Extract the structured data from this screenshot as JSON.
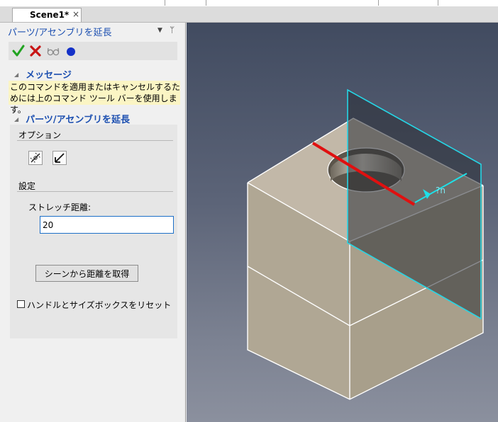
{
  "tab": {
    "title": "Scene1*",
    "close_glyph": "×"
  },
  "panel": {
    "title": "パーツ/アセンブリを延長",
    "menu_glyph": "▼",
    "pin_glyph": "ᛘ",
    "actions": [
      "check-icon",
      "x-icon",
      "glasses-icon",
      "circle-icon"
    ],
    "message": {
      "header": "メッセージ",
      "text": "このコマンドを適用またはキャンセルするためには上のコマンド ツール バーを使用します。"
    },
    "extend": {
      "header": "パーツ/アセンブリを延長",
      "options_label": "オプション",
      "settings_label": "設定",
      "stretch_label": "ストレッチ距離:",
      "stretch_value": "20",
      "get_distance_button": "シーンから距離を取得",
      "reset_label": "ハンドルとサイズボックスをリセット"
    }
  },
  "viewport": {
    "dimension_label": "?n",
    "colors": {
      "face_top": "#c2b8a8",
      "face_left": "#b0a794",
      "face_right": "#a89f8b",
      "edge": "#ffffff",
      "plane": "#2a2e35",
      "plane_border": "#25d6e6",
      "stretch_line": "#e01010",
      "arrow": "#1ee0e8"
    }
  }
}
